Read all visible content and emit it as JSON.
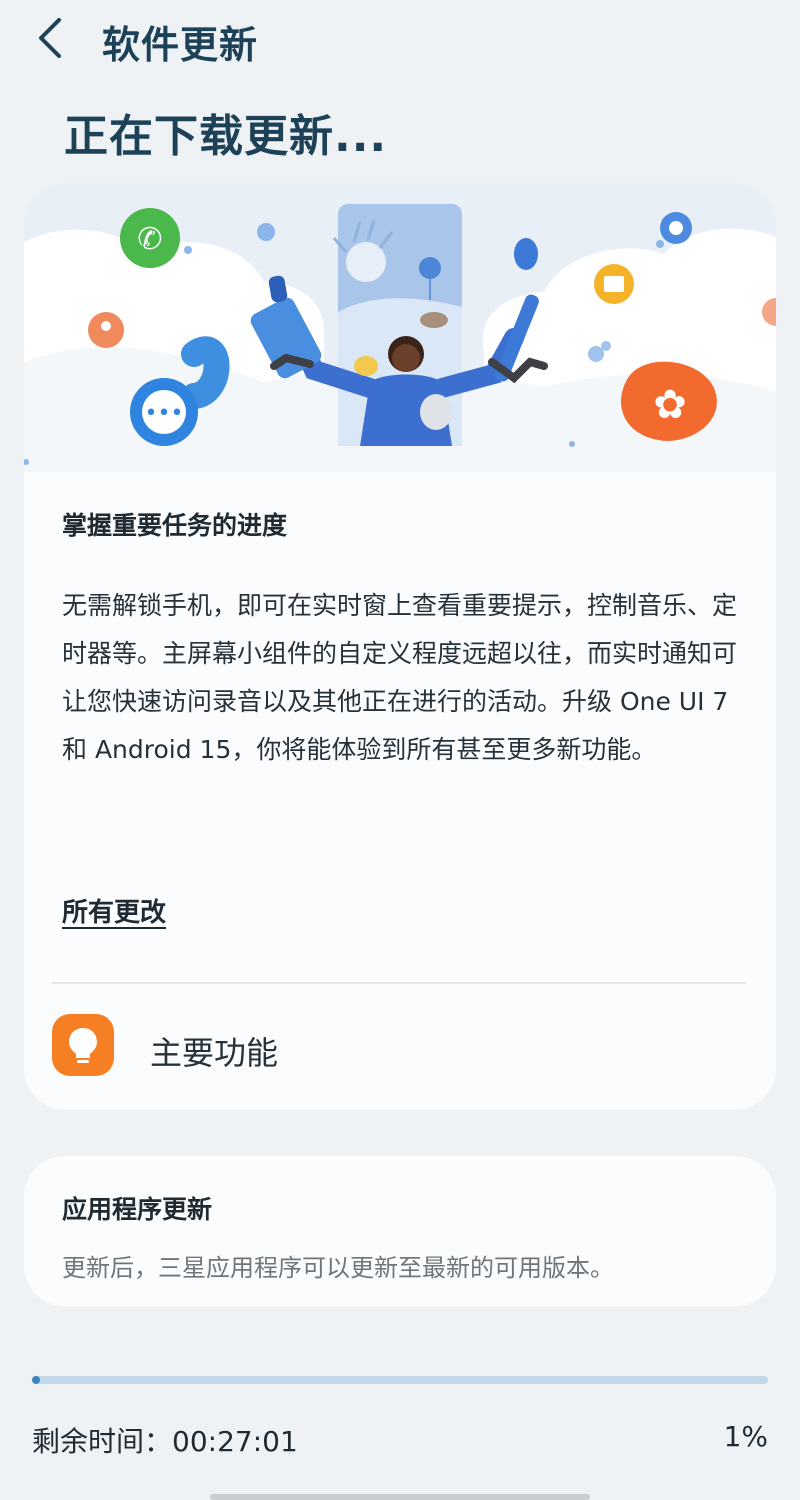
{
  "header": {
    "title": "软件更新",
    "headline": "正在下载更新..."
  },
  "feature_card": {
    "title": "掌握重要任务的进度",
    "description": "无需解锁手机，即可在实时窗上查看重要提示，控制音乐、定时器等。主屏幕小组件的自定义程度远超以往，而实时通知可让您快速访问录音以及其他正在进行的活动。升级 One UI 7 和 Android 15，你将能体验到所有甚至更多新功能。",
    "all_changes_link": "所有更改",
    "main_features_label": "主要功能"
  },
  "app_update_card": {
    "title": "应用程序更新",
    "description": "更新后，三星应用程序可以更新至最新的可用版本。"
  },
  "download": {
    "progress": 0.01,
    "time_remaining": "剩余时间：00:27:01",
    "percent_text": "1%"
  },
  "colors": {
    "accent_dark": "#1d4157",
    "progress_fill": "#3b86c2",
    "progress_track": "#c3d8e6",
    "orange": "#f57f22",
    "background": "#eef2f5"
  },
  "icons": {
    "back": "chevron-left-icon",
    "main_features": "lightbulb-icon"
  }
}
